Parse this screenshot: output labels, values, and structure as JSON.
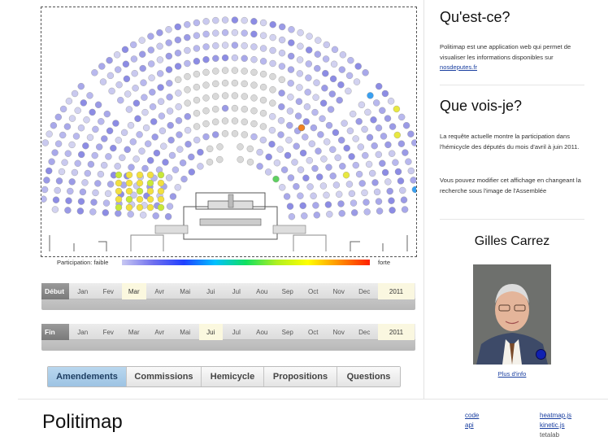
{
  "legend": {
    "low": "Participation: faible",
    "high": "forte"
  },
  "sliders": {
    "start": {
      "label": "Début",
      "months": [
        "Jan",
        "Fev",
        "Mar",
        "Avr",
        "Mai",
        "Jui",
        "Jul",
        "Aou",
        "Sep",
        "Oct",
        "Nov",
        "Dec"
      ],
      "selected": 2,
      "year": "2011"
    },
    "end": {
      "label": "Fin",
      "months": [
        "Jan",
        "Fev",
        "Mar",
        "Avr",
        "Mai",
        "Jui",
        "Jul",
        "Aou",
        "Sep",
        "Oct",
        "Nov",
        "Dec"
      ],
      "selected": 5,
      "year": "2011"
    }
  },
  "tabs": [
    {
      "label": "Amendements",
      "active": true
    },
    {
      "label": "Commissions",
      "active": false
    },
    {
      "label": "Hemicycle",
      "active": false
    },
    {
      "label": "Propositions",
      "active": false
    },
    {
      "label": "Questions",
      "active": false
    }
  ],
  "sidebar": {
    "what": {
      "title": "Qu'est-ce?",
      "text": "Politimap est une application web qui permet de visualiser les informations disponibles sur ",
      "link": "nosdeputes.fr"
    },
    "see": {
      "title": "Que vois-je?",
      "text1": "La requête actuelle montre la participation dans l'hémicycle des députés du mois d'avril à juin 2011.",
      "text2": "Vous pouvez modifier cet affichage en changeant la recherche sous l'image de l'Assemblée"
    },
    "deputy": {
      "name": "Gilles Carrez",
      "more": "Plus d'info"
    }
  },
  "footer": {
    "title": "Politimap",
    "links": {
      "code": "code",
      "api": "api",
      "heatmap": "heatmap.js",
      "kinetic": "kinetic.js",
      "tetalab": "tetalab"
    }
  },
  "colors": {
    "accent": "#9dc3e3",
    "link": "#1a3fa0",
    "low": "#c8c8f2",
    "high": "#ff2000"
  }
}
